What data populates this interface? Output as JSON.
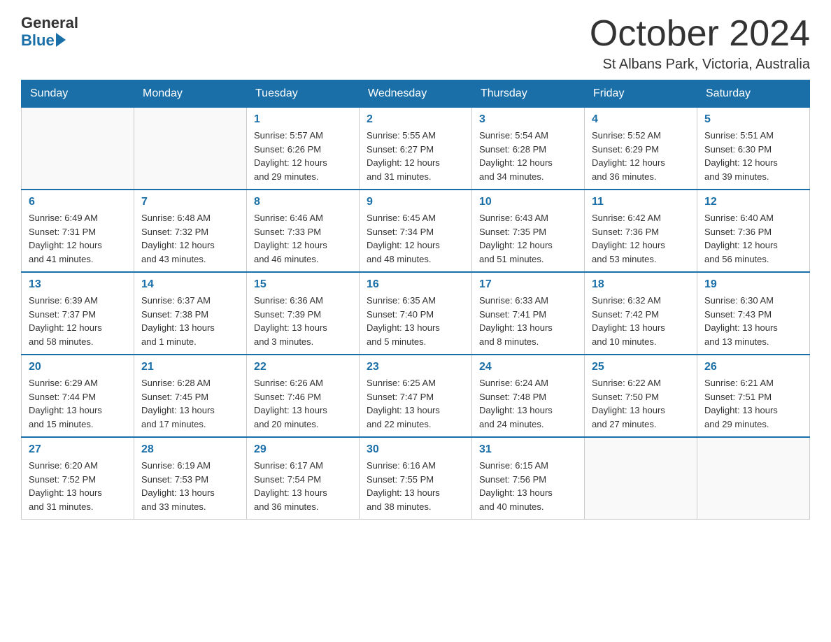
{
  "logo": {
    "text_general": "General",
    "text_blue": "Blue"
  },
  "header": {
    "month_title": "October 2024",
    "location": "St Albans Park, Victoria, Australia"
  },
  "days_of_week": [
    "Sunday",
    "Monday",
    "Tuesday",
    "Wednesday",
    "Thursday",
    "Friday",
    "Saturday"
  ],
  "weeks": [
    [
      {
        "day": "",
        "info": ""
      },
      {
        "day": "",
        "info": ""
      },
      {
        "day": "1",
        "info": "Sunrise: 5:57 AM\nSunset: 6:26 PM\nDaylight: 12 hours\nand 29 minutes."
      },
      {
        "day": "2",
        "info": "Sunrise: 5:55 AM\nSunset: 6:27 PM\nDaylight: 12 hours\nand 31 minutes."
      },
      {
        "day": "3",
        "info": "Sunrise: 5:54 AM\nSunset: 6:28 PM\nDaylight: 12 hours\nand 34 minutes."
      },
      {
        "day": "4",
        "info": "Sunrise: 5:52 AM\nSunset: 6:29 PM\nDaylight: 12 hours\nand 36 minutes."
      },
      {
        "day": "5",
        "info": "Sunrise: 5:51 AM\nSunset: 6:30 PM\nDaylight: 12 hours\nand 39 minutes."
      }
    ],
    [
      {
        "day": "6",
        "info": "Sunrise: 6:49 AM\nSunset: 7:31 PM\nDaylight: 12 hours\nand 41 minutes."
      },
      {
        "day": "7",
        "info": "Sunrise: 6:48 AM\nSunset: 7:32 PM\nDaylight: 12 hours\nand 43 minutes."
      },
      {
        "day": "8",
        "info": "Sunrise: 6:46 AM\nSunset: 7:33 PM\nDaylight: 12 hours\nand 46 minutes."
      },
      {
        "day": "9",
        "info": "Sunrise: 6:45 AM\nSunset: 7:34 PM\nDaylight: 12 hours\nand 48 minutes."
      },
      {
        "day": "10",
        "info": "Sunrise: 6:43 AM\nSunset: 7:35 PM\nDaylight: 12 hours\nand 51 minutes."
      },
      {
        "day": "11",
        "info": "Sunrise: 6:42 AM\nSunset: 7:36 PM\nDaylight: 12 hours\nand 53 minutes."
      },
      {
        "day": "12",
        "info": "Sunrise: 6:40 AM\nSunset: 7:36 PM\nDaylight: 12 hours\nand 56 minutes."
      }
    ],
    [
      {
        "day": "13",
        "info": "Sunrise: 6:39 AM\nSunset: 7:37 PM\nDaylight: 12 hours\nand 58 minutes."
      },
      {
        "day": "14",
        "info": "Sunrise: 6:37 AM\nSunset: 7:38 PM\nDaylight: 13 hours\nand 1 minute."
      },
      {
        "day": "15",
        "info": "Sunrise: 6:36 AM\nSunset: 7:39 PM\nDaylight: 13 hours\nand 3 minutes."
      },
      {
        "day": "16",
        "info": "Sunrise: 6:35 AM\nSunset: 7:40 PM\nDaylight: 13 hours\nand 5 minutes."
      },
      {
        "day": "17",
        "info": "Sunrise: 6:33 AM\nSunset: 7:41 PM\nDaylight: 13 hours\nand 8 minutes."
      },
      {
        "day": "18",
        "info": "Sunrise: 6:32 AM\nSunset: 7:42 PM\nDaylight: 13 hours\nand 10 minutes."
      },
      {
        "day": "19",
        "info": "Sunrise: 6:30 AM\nSunset: 7:43 PM\nDaylight: 13 hours\nand 13 minutes."
      }
    ],
    [
      {
        "day": "20",
        "info": "Sunrise: 6:29 AM\nSunset: 7:44 PM\nDaylight: 13 hours\nand 15 minutes."
      },
      {
        "day": "21",
        "info": "Sunrise: 6:28 AM\nSunset: 7:45 PM\nDaylight: 13 hours\nand 17 minutes."
      },
      {
        "day": "22",
        "info": "Sunrise: 6:26 AM\nSunset: 7:46 PM\nDaylight: 13 hours\nand 20 minutes."
      },
      {
        "day": "23",
        "info": "Sunrise: 6:25 AM\nSunset: 7:47 PM\nDaylight: 13 hours\nand 22 minutes."
      },
      {
        "day": "24",
        "info": "Sunrise: 6:24 AM\nSunset: 7:48 PM\nDaylight: 13 hours\nand 24 minutes."
      },
      {
        "day": "25",
        "info": "Sunrise: 6:22 AM\nSunset: 7:50 PM\nDaylight: 13 hours\nand 27 minutes."
      },
      {
        "day": "26",
        "info": "Sunrise: 6:21 AM\nSunset: 7:51 PM\nDaylight: 13 hours\nand 29 minutes."
      }
    ],
    [
      {
        "day": "27",
        "info": "Sunrise: 6:20 AM\nSunset: 7:52 PM\nDaylight: 13 hours\nand 31 minutes."
      },
      {
        "day": "28",
        "info": "Sunrise: 6:19 AM\nSunset: 7:53 PM\nDaylight: 13 hours\nand 33 minutes."
      },
      {
        "day": "29",
        "info": "Sunrise: 6:17 AM\nSunset: 7:54 PM\nDaylight: 13 hours\nand 36 minutes."
      },
      {
        "day": "30",
        "info": "Sunrise: 6:16 AM\nSunset: 7:55 PM\nDaylight: 13 hours\nand 38 minutes."
      },
      {
        "day": "31",
        "info": "Sunrise: 6:15 AM\nSunset: 7:56 PM\nDaylight: 13 hours\nand 40 minutes."
      },
      {
        "day": "",
        "info": ""
      },
      {
        "day": "",
        "info": ""
      }
    ]
  ]
}
